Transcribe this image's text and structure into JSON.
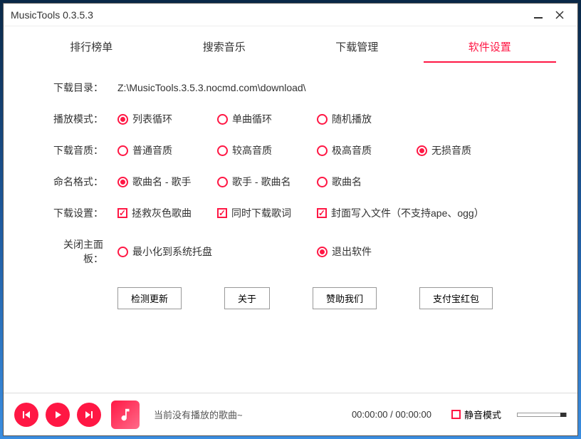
{
  "title": "MusicTools 0.3.5.3",
  "tabs": [
    "排行榜单",
    "搜索音乐",
    "下载管理",
    "软件设置"
  ],
  "activeTab": 3,
  "settings": {
    "downloadDirLabel": "下载目录：",
    "downloadDir": "Z:\\MusicTools.3.5.3.nocmd.com\\download\\",
    "playModeLabel": "播放模式：",
    "playModes": [
      "列表循环",
      "单曲循环",
      "随机播放"
    ],
    "playModeSelected": 0,
    "qualityLabel": "下载音质：",
    "qualities": [
      "普通音质",
      "较高音质",
      "极高音质",
      "无损音质"
    ],
    "qualitySelected": 3,
    "namingLabel": "命名格式：",
    "namings": [
      "歌曲名 - 歌手",
      "歌手 - 歌曲名",
      "歌曲名"
    ],
    "namingSelected": 0,
    "dlSettingLabel": "下载设置：",
    "dlSettings": [
      "拯救灰色歌曲",
      "同时下载歌词",
      "封面写入文件（不支持ape、ogg）"
    ],
    "dlSettingsChecked": [
      true,
      true,
      true
    ],
    "closeLabel": "关闭主面板：",
    "closeOptions": [
      "最小化到系统托盘",
      "退出软件"
    ],
    "closeSelected": 1
  },
  "buttons": [
    "检测更新",
    "关于",
    "赞助我们",
    "支付宝红包"
  ],
  "player": {
    "nowPlaying": "当前没有播放的歌曲~",
    "time": "00:00:00 / 00:00:00",
    "muteLabel": "静音模式"
  }
}
